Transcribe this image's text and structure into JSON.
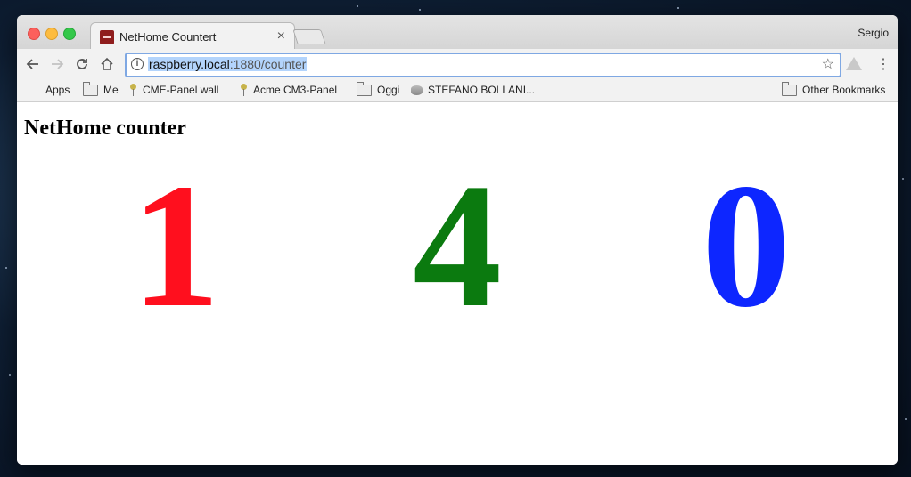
{
  "browser": {
    "tab": {
      "title": "NetHome Countert",
      "close_glyph": "×"
    },
    "profile_name": "Sergio",
    "address_bar": {
      "host": "raspberry.local",
      "path": ":1880/counter"
    }
  },
  "bookmarks": [
    {
      "label": "Apps",
      "icon": "apps-icon"
    },
    {
      "label": "Me",
      "icon": "folder-icon"
    },
    {
      "label": "CME-Panel wall",
      "icon": "pin-icon"
    },
    {
      "label": "Acme CM3-Panel",
      "icon": "pin-icon"
    },
    {
      "label": "Oggi",
      "icon": "folder-icon"
    },
    {
      "label": "STEFANO BOLLANI...",
      "icon": "disk-icon"
    }
  ],
  "other_bookmarks": "Other Bookmarks",
  "page": {
    "heading": "NetHome counter",
    "counters": [
      {
        "value": "1",
        "color": "#ff0f1e"
      },
      {
        "value": "4",
        "color": "#0b7a0f"
      },
      {
        "value": "0",
        "color": "#0d26ff"
      }
    ]
  }
}
